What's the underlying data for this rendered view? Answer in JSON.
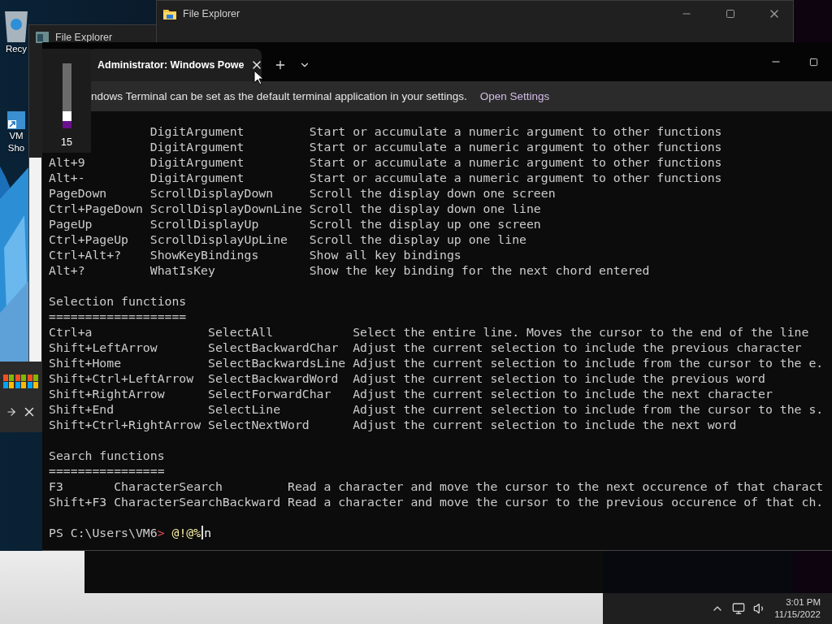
{
  "desktop": {
    "icons": [
      {
        "kind": "recycle",
        "lines": [
          "Recy"
        ]
      },
      {
        "kind": "shortcut",
        "lines": [
          "VM",
          "Sho"
        ]
      }
    ]
  },
  "file_explorer_back": {
    "title": "File Explorer"
  },
  "file_explorer_front": {
    "title": "File Explorer"
  },
  "volume_flyout": {
    "level": 0.15,
    "reading": "15"
  },
  "terminal": {
    "tab": {
      "title": "Administrator: Windows Powe"
    },
    "notice": {
      "text": "ndows Terminal can be set as the default terminal application in your settings.",
      "link": "Open Settings"
    },
    "sections": [
      {
        "rows": [
          {
            "function": "DigitArgument",
            "description": "Start or accumulate a numeric argument to other functions"
          },
          {
            "function": "DigitArgument",
            "description": "Start or accumulate a numeric argument to other functions"
          },
          {
            "key": "Alt+9",
            "function": "DigitArgument",
            "description": "Start or accumulate a numeric argument to other functions"
          },
          {
            "key": "Alt+-",
            "function": "DigitArgument",
            "description": "Start or accumulate a numeric argument to other functions"
          },
          {
            "key": "PageDown",
            "function": "ScrollDisplayDown",
            "description": "Scroll the display down one screen"
          },
          {
            "key": "Ctrl+PageDown",
            "function": "ScrollDisplayDownLine",
            "description": "Scroll the display down one line"
          },
          {
            "key": "PageUp",
            "function": "ScrollDisplayUp",
            "description": "Scroll the display up one screen"
          },
          {
            "key": "Ctrl+PageUp",
            "function": "ScrollDisplayUpLine",
            "description": "Scroll the display up one line"
          },
          {
            "key": "Ctrl+Alt+?",
            "function": "ShowKeyBindings",
            "description": "Show all key bindings"
          },
          {
            "key": "Alt+?",
            "function": "WhatIsKey",
            "description": "Show the key binding for the next chord entered"
          }
        ]
      },
      {
        "title": "Selection functions",
        "rule": "===================",
        "rows": [
          {
            "key": "Ctrl+a",
            "function": "SelectAll",
            "description": "Select the entire line. Moves the cursor to the end of the line"
          },
          {
            "key": "Shift+LeftArrow",
            "function": "SelectBackwardChar",
            "description": "Adjust the current selection to include the previous character"
          },
          {
            "key": "Shift+Home",
            "function": "SelectBackwardsLine",
            "description": "Adjust the current selection to include from the cursor to the e."
          },
          {
            "key": "Shift+Ctrl+LeftArrow",
            "function": "SelectBackwardWord",
            "description": "Adjust the current selection to include the previous word"
          },
          {
            "key": "Shift+RightArrow",
            "function": "SelectForwardChar",
            "description": "Adjust the current selection to include the next character"
          },
          {
            "key": "Shift+End",
            "function": "SelectLine",
            "description": "Adjust the current selection to include from the cursor to the s."
          },
          {
            "key": "Shift+Ctrl+RightArrow",
            "function": "SelectNextWord",
            "description": "Adjust the current selection to include the next word"
          }
        ]
      },
      {
        "title": "Search functions",
        "rule": "================",
        "rows": [
          {
            "key": "F3",
            "function": "CharacterSearch",
            "description": "Read a character and move the cursor to the next occurence of that charact"
          },
          {
            "key": "Shift+F3",
            "function": "CharacterSearchBackward",
            "description": "Read a character and move the cursor to the previous occurence of that ch."
          }
        ]
      }
    ],
    "prompt": {
      "path": "PS C:\\Users\\VM6",
      "marker": ">",
      "input": "@!@%",
      "after_cursor": "n"
    }
  },
  "taskbar": {
    "time": "3:01 PM",
    "date": "11/15/2022"
  }
}
